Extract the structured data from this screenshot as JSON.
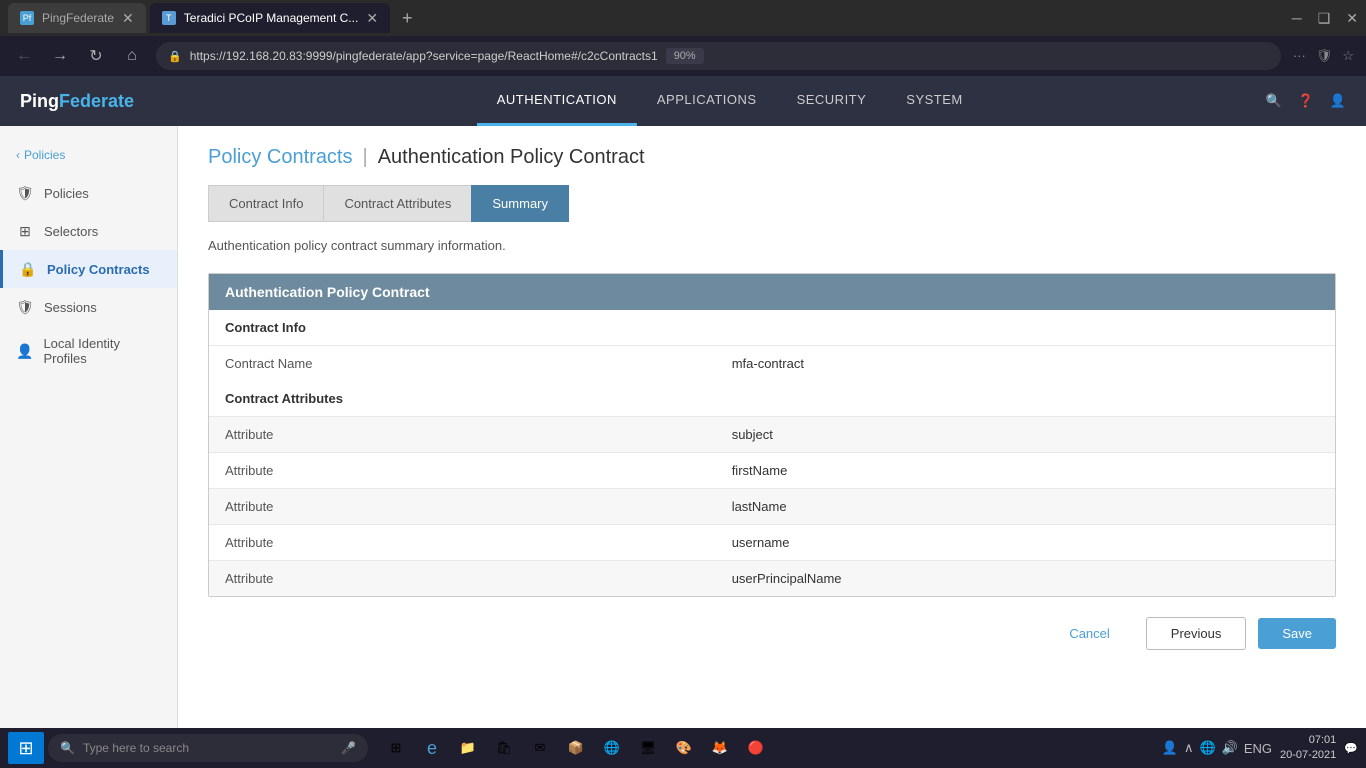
{
  "browser": {
    "tabs": [
      {
        "id": "tab1",
        "label": "PingFederate",
        "favicon": "Pf",
        "active": false
      },
      {
        "id": "tab2",
        "label": "Teradici PCoIP Management C...",
        "favicon": "T",
        "active": true
      }
    ],
    "url": "https://192.168.20.83:9999/pingfederate/app?service=page/ReactHome#/c2cContracts1",
    "zoom": "90%"
  },
  "nav": {
    "items": [
      {
        "label": "AUTHENTICATION",
        "active": true
      },
      {
        "label": "APPLICATIONS",
        "active": false
      },
      {
        "label": "SECURITY",
        "active": false
      },
      {
        "label": "SYSTEM",
        "active": false
      }
    ]
  },
  "sidebar": {
    "collapse_label": "Policies",
    "items": [
      {
        "id": "policies",
        "label": "Policies",
        "icon": "🛡"
      },
      {
        "id": "selectors",
        "label": "Selectors",
        "icon": "⊞"
      },
      {
        "id": "policy-contracts",
        "label": "Policy Contracts",
        "icon": "🔒",
        "active": true
      },
      {
        "id": "sessions",
        "label": "Sessions",
        "icon": "🛡"
      },
      {
        "id": "local-identity-profiles",
        "label": "Local Identity Profiles",
        "icon": "👤"
      }
    ]
  },
  "page": {
    "breadcrumb_link": "Policy Contracts",
    "breadcrumb_sep": "|",
    "breadcrumb_current": "Authentication Policy Contract",
    "description": "Authentication policy contract summary information.",
    "tabs": [
      {
        "id": "contract-info",
        "label": "Contract Info",
        "active": false
      },
      {
        "id": "contract-attributes",
        "label": "Contract Attributes",
        "active": false
      },
      {
        "id": "summary",
        "label": "Summary",
        "active": true
      }
    ],
    "panel": {
      "header": "Authentication Policy Contract",
      "sections": [
        {
          "title": "Contract Info",
          "rows": [
            {
              "label": "Contract Name",
              "value": "mfa-contract"
            }
          ]
        },
        {
          "title": "Contract Attributes",
          "rows": [
            {
              "label": "Attribute",
              "value": "subject"
            },
            {
              "label": "Attribute",
              "value": "firstName"
            },
            {
              "label": "Attribute",
              "value": "lastName"
            },
            {
              "label": "Attribute",
              "value": "username"
            },
            {
              "label": "Attribute",
              "value": "userPrincipalName"
            }
          ]
        }
      ]
    },
    "buttons": {
      "cancel": "Cancel",
      "previous": "Previous",
      "save": "Save"
    }
  },
  "taskbar": {
    "search_placeholder": "Type here to search",
    "datetime": "07:01\n20-07-2021",
    "lang": "ENG"
  }
}
